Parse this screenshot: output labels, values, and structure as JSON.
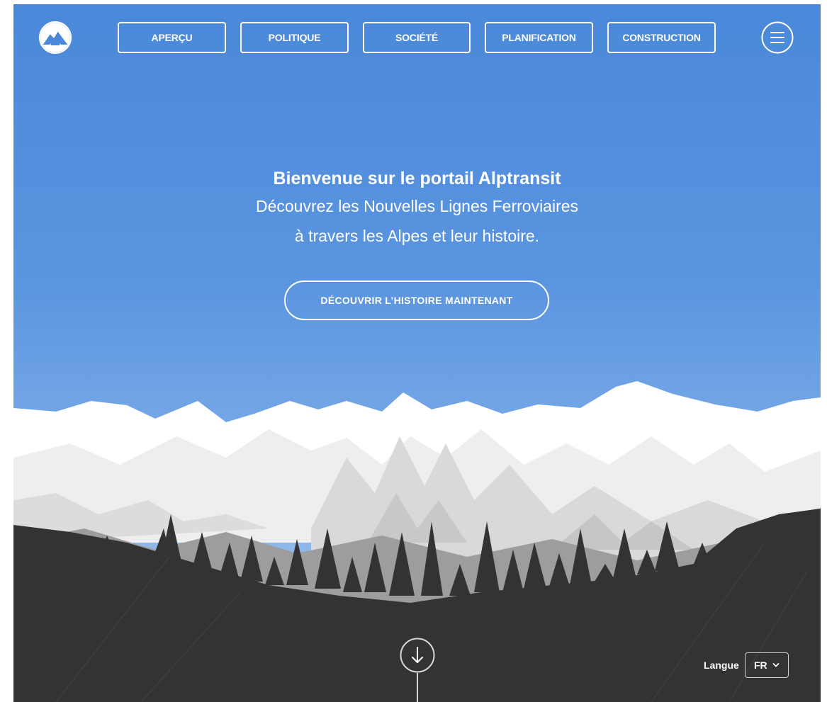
{
  "nav": {
    "items": [
      {
        "label": "APERÇU",
        "name": "nav-apercu"
      },
      {
        "label": "POLITIQUE",
        "name": "nav-politique"
      },
      {
        "label": "SOCIÉTÉ",
        "name": "nav-societe"
      },
      {
        "label": "PLANIFICATION",
        "name": "nav-planification"
      },
      {
        "label": "CONSTRUCTION",
        "name": "nav-construction"
      }
    ]
  },
  "hero": {
    "title": "Bienvenue sur le portail Alptransit",
    "subtitle_line1": "Découvrez les Nouvelles Lignes Ferroviaires",
    "subtitle_line2": "à travers les Alpes et leur histoire.",
    "cta_label": "DÉCOUVRIR L’HISTOIRE MAINTENANT"
  },
  "language": {
    "label": "Langue",
    "selected": "FR"
  },
  "icons": {
    "logo": "alptransit-logo-icon",
    "menu": "hamburger-menu-icon",
    "scroll": "arrow-down-icon",
    "dropdown": "chevron-down-icon"
  },
  "colors": {
    "sky_top": "#4a88d9",
    "sky_bottom": "#8fb8ea",
    "forest": "#333333",
    "snow": "#f4f5f6"
  }
}
